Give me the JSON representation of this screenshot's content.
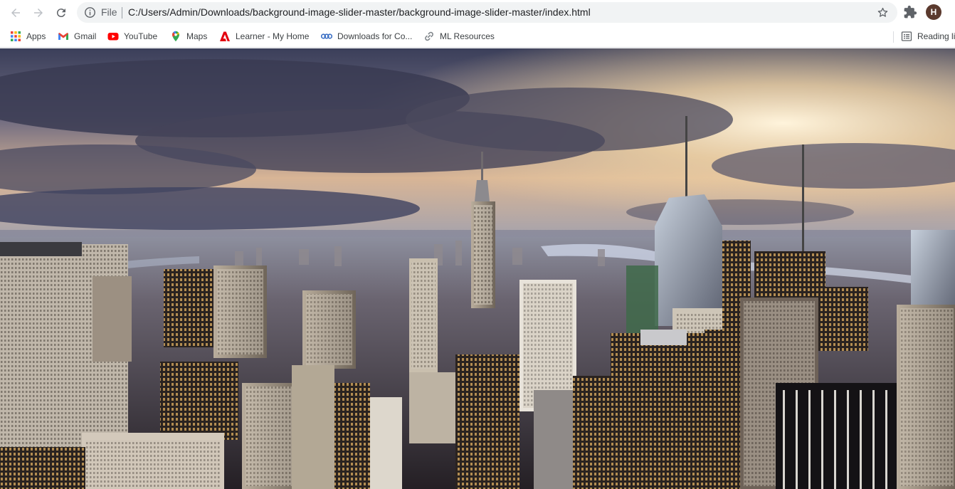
{
  "browser": {
    "omnibox": {
      "scheme_label": "File",
      "url": "C:/Users/Admin/Downloads/background-image-slider-master/background-image-slider-master/index.html"
    },
    "profile_initial": "H"
  },
  "bookmarks": [
    {
      "label": "Apps",
      "icon": "apps-grid-icon"
    },
    {
      "label": "Gmail",
      "icon": "gmail-icon"
    },
    {
      "label": "YouTube",
      "icon": "youtube-icon"
    },
    {
      "label": "Maps",
      "icon": "maps-pin-icon"
    },
    {
      "label": "Learner - My Home",
      "icon": "adobe-icon"
    },
    {
      "label": "Downloads for Co...",
      "icon": "ccs-icon"
    },
    {
      "label": "ML Resources",
      "icon": "link-icon"
    },
    {
      "label": "Reading li",
      "icon": "reading-list-icon"
    }
  ],
  "colors": {
    "toolbar_bg": "#ffffff",
    "omnibox_bg": "#f1f3f4",
    "avatar_bg": "#5b3a2e",
    "sky_top": "#3b3f5a",
    "horizon_glow": "#f3d6a6",
    "city_dark": "#1b1a22"
  },
  "hero": {
    "description_icon": "city-skyline-photo"
  }
}
